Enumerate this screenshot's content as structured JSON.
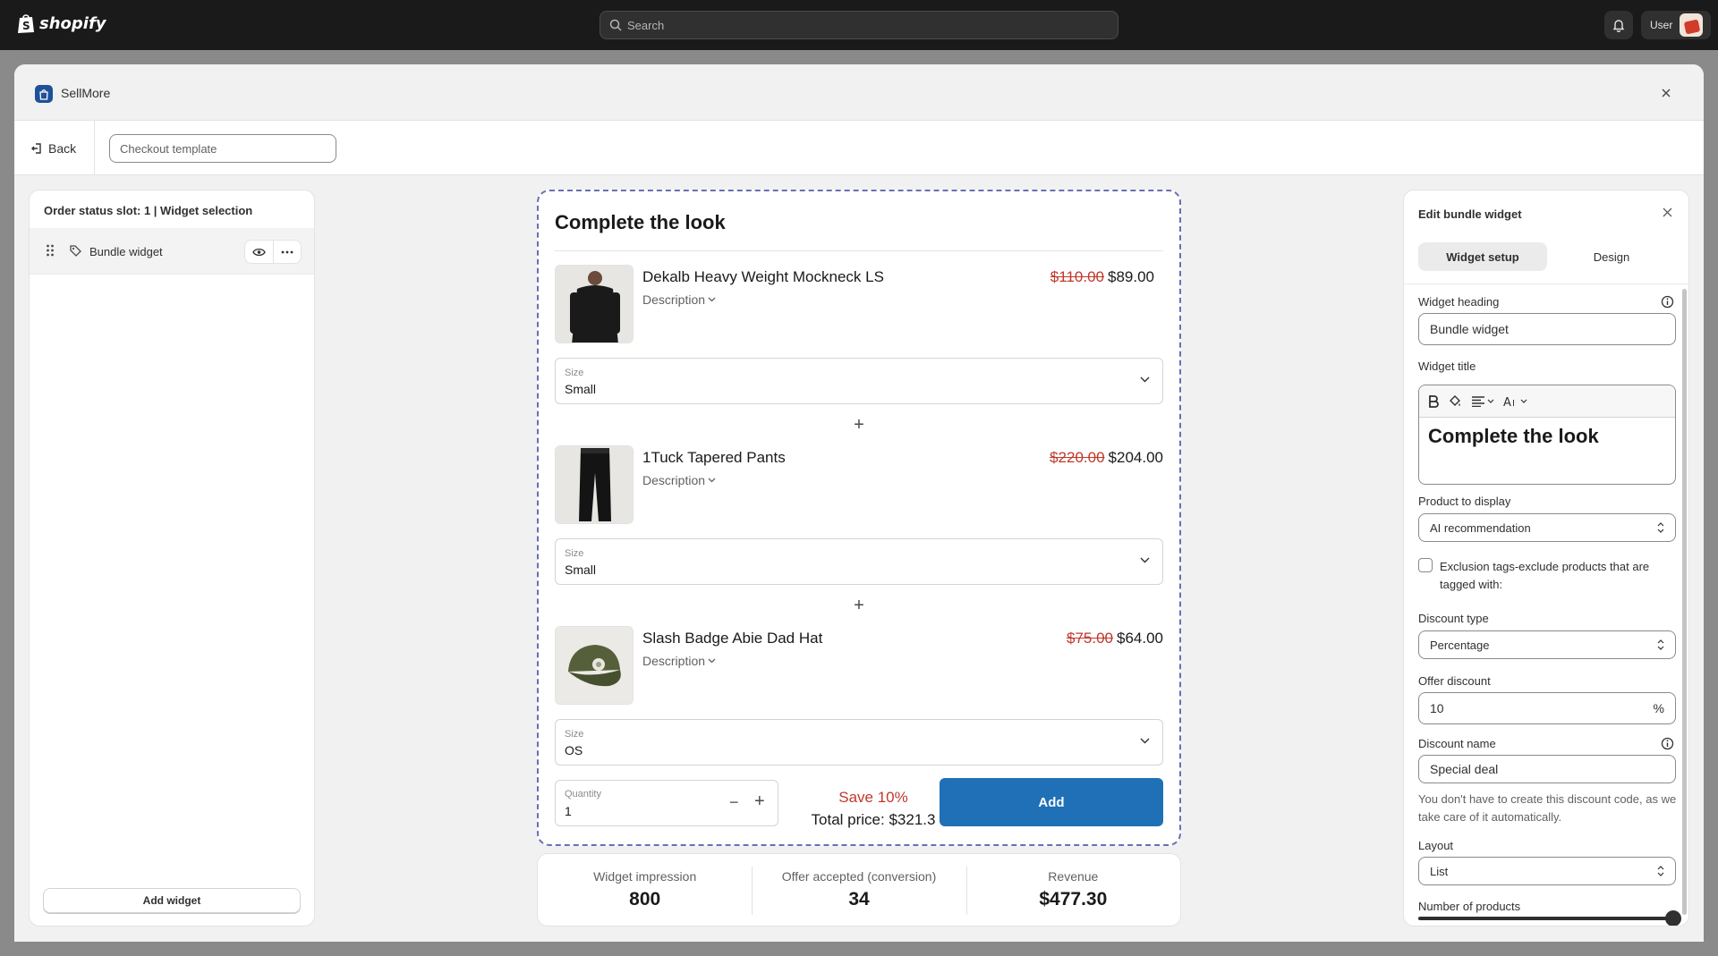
{
  "topbar": {
    "brand": "shopify",
    "search_placeholder": "Search",
    "user_name": "User"
  },
  "modal": {
    "app_name": "SellMore",
    "back_label": "Back",
    "template_placeholder": "Checkout template"
  },
  "left_panel": {
    "title": "Order status slot: 1 | Widget selection",
    "widget_label": "Bundle widget",
    "add_widget_label": "Add widget"
  },
  "preview": {
    "title": "Complete the look",
    "products": [
      {
        "name": "Dekalb Heavy Weight Mockneck LS",
        "description_label": "Description",
        "old_price": "$110.00",
        "new_price": "$89.00",
        "size_label": "Size",
        "size_value": "Small"
      },
      {
        "name": "1Tuck Tapered Pants",
        "description_label": "Description",
        "old_price": "$220.00",
        "new_price": "$204.00",
        "size_label": "Size",
        "size_value": "Small"
      },
      {
        "name": "Slash Badge Abie Dad Hat",
        "description_label": "Description",
        "old_price": "$75.00",
        "new_price": "$64.00",
        "size_label": "Size",
        "size_value": "OS"
      }
    ],
    "plus_symbol": "+",
    "quantity_label": "Quantity",
    "quantity_value": "1",
    "save_text": "Save 10%",
    "total_text": "Total price: $321.3",
    "add_label": "Add"
  },
  "stats": [
    {
      "label": "Widget impression",
      "value": "800"
    },
    {
      "label": "Offer accepted (conversion)",
      "value": "34"
    },
    {
      "label": "Revenue",
      "value": "$477.30"
    }
  ],
  "right_panel": {
    "title": "Edit bundle widget",
    "tabs": [
      "Widget setup",
      "Design"
    ],
    "widget_heading_label": "Widget heading",
    "widget_heading_value": "Bundle widget",
    "widget_title_label": "Widget title",
    "widget_title_value": "Complete the look",
    "product_display_label": "Product to display",
    "product_display_value": "AI recommendation",
    "exclusion_label": "Exclusion tags-exclude products that are tagged with:",
    "discount_type_label": "Discount type",
    "discount_type_value": "Percentage",
    "offer_discount_label": "Offer discount",
    "offer_discount_value": "10",
    "offer_discount_suffix": "%",
    "discount_name_label": "Discount name",
    "discount_name_value": "Special deal",
    "discount_help": "You don't have to create this discount code, as we take care of it automatically.",
    "layout_label": "Layout",
    "layout_value": "List",
    "num_products_label": "Number of products"
  },
  "colors": {
    "accent_button": "#1f70b7",
    "strike_price": "#c0392b",
    "preview_border": "#6a6fb3",
    "topbar": "#1a1a1a"
  }
}
